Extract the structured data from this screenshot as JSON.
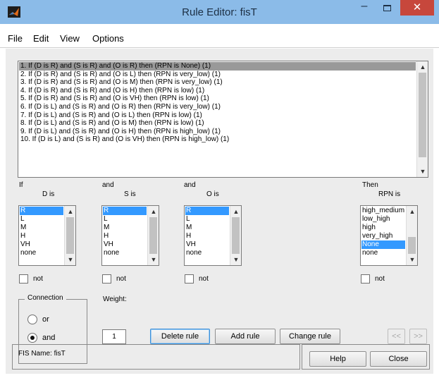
{
  "window": {
    "title": "Rule Editor: fisT",
    "minimize_glyph": "–",
    "close_glyph": "✕",
    "app_icon": "matlab-logo-icon"
  },
  "menu": [
    "File",
    "Edit",
    "View",
    "Options"
  ],
  "rules": {
    "items": [
      "1. If (D is R) and (S is R) and (O is R) then (RPN is None) (1)",
      "2. If (D is R) and (S is R) and (O is L) then (RPN is very_low) (1)",
      "3. If (D is R) and (S is R) and (O is M) then (RPN is very_low) (1)",
      "4. If (D is R) and (S is R) and (O is H) then (RPN is low) (1)",
      "5. If (D is R) and (S is R) and (O is VH) then (RPN is low) (1)",
      "6. If (D is L) and (S is R) and (O is R) then (RPN is very_low) (1)",
      "7. If (D is L) and (S is R) and (O is L) then (RPN is low) (1)",
      "8. If (D is L) and (S is R) and (O is M) then (RPN is low) (1)",
      "9. If (D is L) and (S is R) and (O is H) then (RPN is high_low) (1)",
      "10. If (D is L) and (S is R) and (O is VH) then (RPN is high_low) (1)"
    ],
    "selected_index": 0,
    "scroll_up_glyph": "▲",
    "scroll_down_glyph": "▼"
  },
  "antecedents": [
    {
      "connector": "If",
      "header": "D is",
      "items": [
        "R",
        "L",
        "M",
        "H",
        "VH",
        "none"
      ],
      "selected": "R",
      "not_label": "not"
    },
    {
      "connector": "and",
      "header": "S is",
      "items": [
        "R",
        "L",
        "M",
        "H",
        "VH",
        "none"
      ],
      "selected": "R",
      "not_label": "not"
    },
    {
      "connector": "and",
      "header": "O is",
      "items": [
        "R",
        "L",
        "M",
        "H",
        "VH",
        "none"
      ],
      "selected": "R",
      "not_label": "not"
    }
  ],
  "consequent": {
    "connector": "Then",
    "header": "RPN is",
    "items": [
      "high_medium",
      "low_high",
      "high",
      "very_high",
      "None",
      "none"
    ],
    "selected": "None",
    "not_label": "not"
  },
  "connection": {
    "title": "Connection",
    "options": [
      "or",
      "and"
    ],
    "selected": "and"
  },
  "weight": {
    "label": "Weight:",
    "value": "1"
  },
  "buttons": {
    "delete_rule": "Delete rule",
    "add_rule": "Add rule",
    "change_rule": "Change rule",
    "prev": "<<",
    "next": ">>",
    "help": "Help",
    "close": "Close"
  },
  "status": {
    "fis_name": "FIS Name: fisT"
  }
}
